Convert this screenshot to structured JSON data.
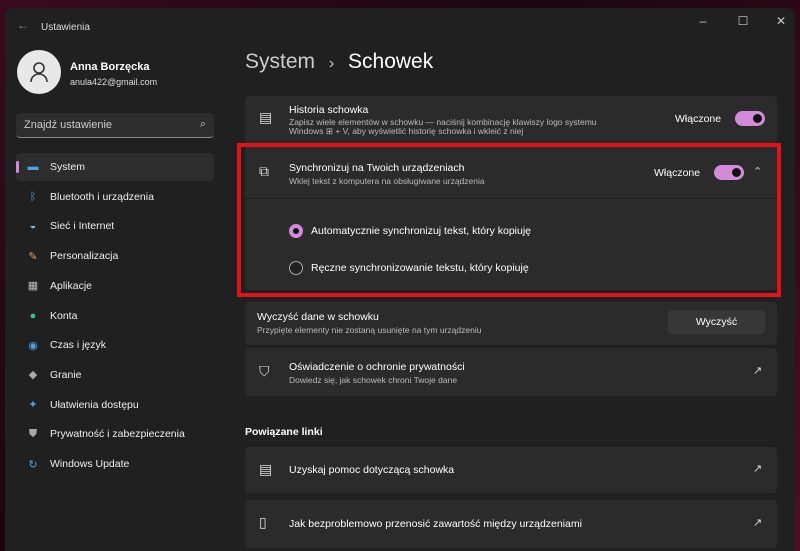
{
  "window": {
    "title": "Ustawienia",
    "minimize": "–",
    "maximize": "☐",
    "close": "✕",
    "back": "←"
  },
  "user": {
    "name": "Anna Borzęcka",
    "email": "anula422@gmail.com"
  },
  "search": {
    "placeholder": "Znajdź ustawienie"
  },
  "sidebar": {
    "items": [
      {
        "label": "System",
        "icon": "monitor-icon",
        "glyph": "▬",
        "color": "#4aa3e8",
        "selected": true
      },
      {
        "label": "Bluetooth i urządzenia",
        "icon": "bluetooth-icon",
        "glyph": "ᛒ",
        "color": "#4aa3e8"
      },
      {
        "label": "Sieć i Internet",
        "icon": "wifi-icon",
        "glyph": "◒",
        "color": "#7ac0f0"
      },
      {
        "label": "Personalizacja",
        "icon": "brush-icon",
        "glyph": "✎",
        "color": "#e0a060"
      },
      {
        "label": "Aplikacje",
        "icon": "apps-icon",
        "glyph": "▦",
        "color": "#bbbbbb"
      },
      {
        "label": "Konta",
        "icon": "account-icon",
        "glyph": "●",
        "color": "#3cc08a"
      },
      {
        "label": "Czas i język",
        "icon": "globe-clock-icon",
        "glyph": "◉",
        "color": "#4aa3e8"
      },
      {
        "label": "Granie",
        "icon": "gamepad-icon",
        "glyph": "◆",
        "color": "#aaaaaa"
      },
      {
        "label": "Ułatwienia dostępu",
        "icon": "accessibility-icon",
        "glyph": "✦",
        "color": "#4aa3e8"
      },
      {
        "label": "Prywatność i zabezpieczenia",
        "icon": "shield-icon",
        "glyph": "⛊",
        "color": "#aaaaaa"
      },
      {
        "label": "Windows Update",
        "icon": "update-icon",
        "glyph": "↻",
        "color": "#4aa3e8"
      }
    ]
  },
  "breadcrumb": {
    "parent": "System",
    "separator": "›",
    "current": "Schowek"
  },
  "accent": "#d38ad8",
  "history": {
    "title": "Historia schowka",
    "desc1": "Zapisz wiele elementów w schowku — naciśnij kombinację klawiszy logo systemu",
    "desc2": "Windows ⊞ + V, aby wyświetlić historię schowka i wkleić z niej",
    "state": "Włączone",
    "on": true
  },
  "sync": {
    "title": "Synchronizuj na Twoich urządzeniach",
    "desc": "Wklej tekst z komputera na obsługiwane urządzenia",
    "state": "Włączone",
    "on": true,
    "expanded": true,
    "options": [
      {
        "label": "Automatycznie synchronizuj tekst, który kopiuję",
        "selected": true
      },
      {
        "label": "Ręczne synchronizowanie tekstu, który kopiuję",
        "selected": false
      }
    ]
  },
  "clear": {
    "title": "Wyczyść dane w schowku",
    "desc": "Przypięte elementy nie zostaną usunięte na tym urządzeniu",
    "button": "Wyczyść"
  },
  "privacy": {
    "title": "Oświadczenie o ochronie prywatności",
    "desc": "Dowiedz się, jak schowek chroni Twoje dane"
  },
  "related": {
    "heading": "Powiązane linki",
    "links": [
      {
        "label": "Uzyskaj pomoc dotyczącą schowka"
      },
      {
        "label": "Jak bezproblemowo przenosić zawartość między urządzeniami"
      }
    ]
  }
}
